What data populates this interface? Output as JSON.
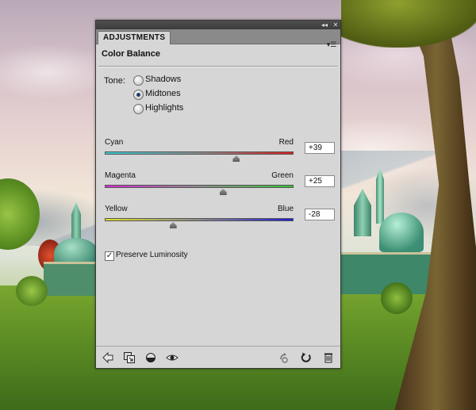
{
  "panel": {
    "tab_label": "ADJUSTMENTS",
    "title": "Color Balance",
    "collapse_icon": "collapse-arrows-icon",
    "close_icon": "close-icon",
    "menu_icon": "panel-menu-icon"
  },
  "tone": {
    "label": "Tone:",
    "options": [
      {
        "label": "Shadows",
        "selected": false
      },
      {
        "label": "Midtones",
        "selected": true
      },
      {
        "label": "Highlights",
        "selected": false
      }
    ]
  },
  "sliders": [
    {
      "left_label": "Cyan",
      "right_label": "Red",
      "value": "+39",
      "numeric": 39,
      "left_color": "#38c8d4",
      "right_color": "#d81e1e"
    },
    {
      "left_label": "Magenta",
      "right_label": "Green",
      "value": "+25",
      "numeric": 25,
      "left_color": "#d42ad2",
      "right_color": "#38c238"
    },
    {
      "left_label": "Yellow",
      "right_label": "Blue",
      "value": "-28",
      "numeric": -28,
      "left_color": "#e2df2a",
      "right_color": "#1c1cd6"
    }
  ],
  "slider_range": [
    -100,
    100
  ],
  "preserve": {
    "label": "Preserve Luminosity",
    "checked": true
  },
  "footer_icons": [
    "return-to-list-icon",
    "clip-to-layer-icon",
    "layer-visibility-toggle-icon",
    "eye-icon",
    "previous-state-icon",
    "reset-icon",
    "trash-icon"
  ]
}
